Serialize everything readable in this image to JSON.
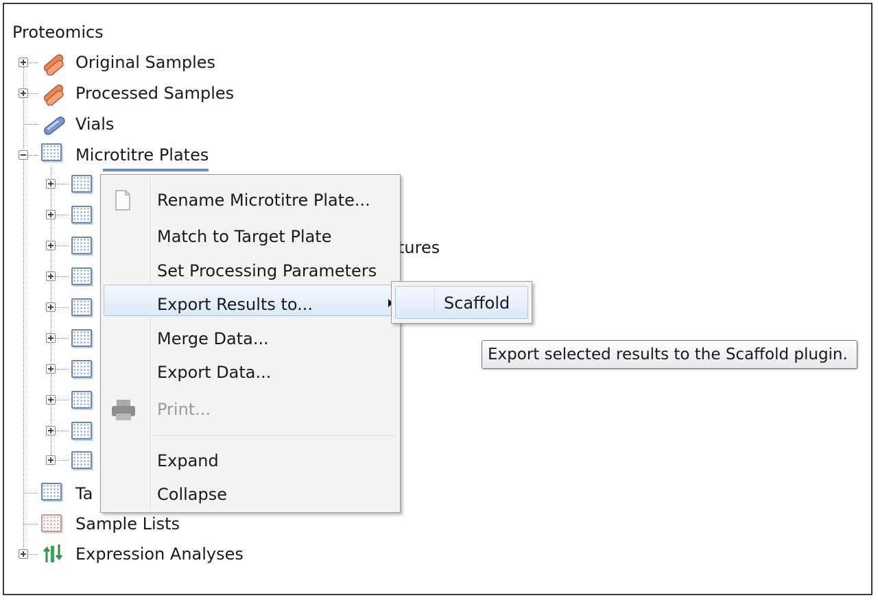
{
  "tree": {
    "root_label": "Proteomics",
    "items": [
      {
        "label": "Original Samples",
        "icon": "tube-orange-icon",
        "expander": "plus"
      },
      {
        "label": "Processed Samples",
        "icon": "tube-orange-icon",
        "expander": "plus"
      },
      {
        "label": "Vials",
        "icon": "tube-blue-icon",
        "expander": "none"
      },
      {
        "label": "Microtitre Plates",
        "icon": "microtitre-plate-icon",
        "expander": "minus"
      },
      {
        "label": "Ta",
        "icon": "target-plate-icon",
        "expander": "none"
      },
      {
        "label": "Sample Lists",
        "icon": "sample-list-icon",
        "expander": "none"
      },
      {
        "label": "Expression Analyses",
        "icon": "expression-analysis-icon",
        "expander": "plus"
      }
    ],
    "partial_hidden_text": "tures",
    "child_plate_count": 10
  },
  "context_menu": {
    "items": [
      {
        "label": "Rename Microtitre Plate...",
        "icon": "document-icon",
        "enabled": true
      },
      {
        "label": "Match to Target Plate",
        "enabled": true
      },
      {
        "label": "Set Processing Parameters",
        "enabled": true
      },
      {
        "label": "Export Results to...",
        "enabled": true,
        "submenu": true,
        "highlighted": true
      },
      {
        "label": "Merge Data...",
        "enabled": true
      },
      {
        "label": "Export Data...",
        "enabled": true
      },
      {
        "label": "Print...",
        "icon": "printer-icon",
        "enabled": false
      },
      {
        "label": "Expand",
        "enabled": true
      },
      {
        "label": "Collapse",
        "enabled": true
      }
    ]
  },
  "submenu": {
    "items": [
      {
        "label": "Scaffold"
      }
    ]
  },
  "tooltip": {
    "text": "Export selected results to the Scaffold plugin."
  },
  "colors": {
    "highlight_border": "#a9c4e4",
    "menu_background": "#f3f3f3",
    "tube_orange": "#e8885a",
    "tube_blue": "#7c97cf",
    "expression_green": "#3aa55a"
  }
}
